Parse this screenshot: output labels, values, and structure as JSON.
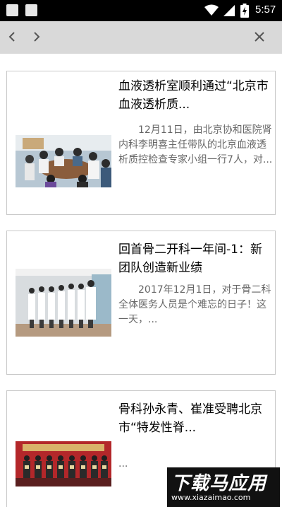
{
  "status_bar": {
    "time": "5:57"
  },
  "nav": {
    "back_icon": "chevron-left-icon",
    "forward_icon": "chevron-right-icon",
    "close_icon": "close-icon"
  },
  "articles": [
    {
      "title": "血液透析室顺利通过“北京市血液透析质...",
      "summary": "12月11日，由北京协和医院肾内科李明喜主任带队的北京血液透析质控检查专家小组一行7人，对..."
    },
    {
      "title": "回首骨二开科一年间-1：新团队创造新业绩",
      "summary": "2017年12月1日，对于骨二科全体医务人员是个难忘的日子！这一天，..."
    },
    {
      "title": "骨科孙永青、崔准受聘北京市“特发性脊...",
      "summary": "..."
    }
  ],
  "watermark": {
    "logo": "下载马应用",
    "url": "www.xiazaimao.com"
  }
}
